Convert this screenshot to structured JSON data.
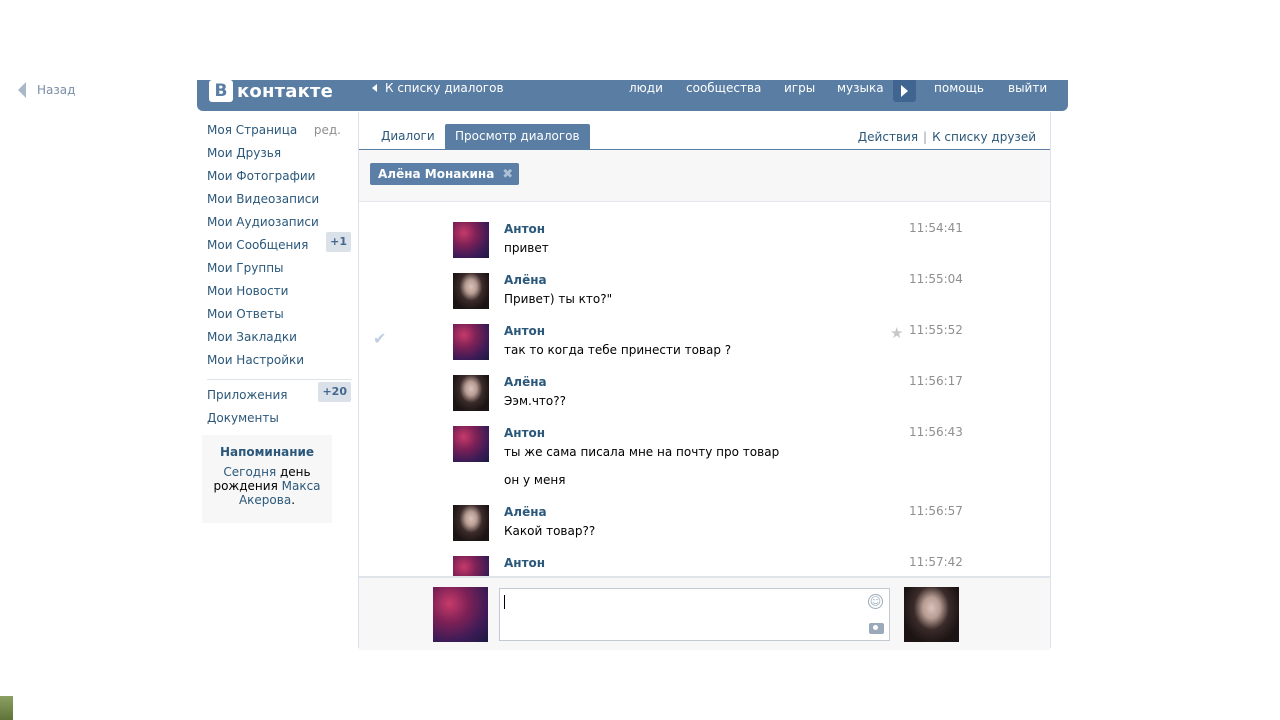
{
  "back": {
    "label": "Назад"
  },
  "header": {
    "logo": {
      "letter": "В",
      "text": "контакте"
    },
    "to_dialogs": "К списку диалогов",
    "nav": [
      "люди",
      "сообщества",
      "игры",
      "музыка",
      "помощь",
      "выйти"
    ]
  },
  "sidebar": {
    "items": [
      {
        "label": "Моя Страница",
        "extra": "ред."
      },
      {
        "label": "Мои Друзья"
      },
      {
        "label": "Мои Фотографии"
      },
      {
        "label": "Мои Видеозаписи"
      },
      {
        "label": "Мои Аудиозаписи"
      },
      {
        "label": "Мои Сообщения",
        "badge": "+1"
      },
      {
        "label": "Мои Группы"
      },
      {
        "label": "Мои Новости"
      },
      {
        "label": "Мои Ответы"
      },
      {
        "label": "Мои Закладки"
      },
      {
        "label": "Мои Настройки"
      }
    ],
    "items2": [
      {
        "label": "Приложения",
        "badge": "+20"
      },
      {
        "label": "Документы"
      }
    ],
    "reminder": {
      "title": "Напоминание",
      "today": "Сегодня",
      "text1": " день рождения ",
      "name": "Макса Акерова",
      "text2": "."
    }
  },
  "tabs": {
    "dialogs": "Диалоги",
    "view": "Просмотр диалогов",
    "actions": "Действия",
    "friends": "К списку друзей"
  },
  "peer": {
    "name": "Алёна Монакина",
    "close": "✖"
  },
  "messages": [
    {
      "author": "Антон",
      "time": "11:54:41",
      "lines": [
        "привет"
      ]
    },
    {
      "author": "Алёна",
      "time": "11:55:04",
      "lines": [
        "Привет) ты кто?\""
      ]
    },
    {
      "author": "Антон",
      "time": "11:55:52",
      "lines": [
        "так то когда тебе принести товар ?"
      ]
    },
    {
      "author": "Алёна",
      "time": "11:56:17",
      "lines": [
        "Ээм.что??"
      ]
    },
    {
      "author": "Антон",
      "time": "11:56:43",
      "lines": [
        "ты же сама писала мне на почту про товар",
        "он у меня"
      ]
    },
    {
      "author": "Алёна",
      "time": "11:56:57",
      "lines": [
        "Какой товар??"
      ]
    },
    {
      "author": "Антон",
      "time": "11:57:42",
      "lines": []
    }
  ],
  "icons": {
    "check": "✔",
    "star": "★",
    "smile": "☺"
  },
  "colors": {
    "brand": "#597da3",
    "link": "#2b587a",
    "badge_bg": "#dae1e8"
  }
}
